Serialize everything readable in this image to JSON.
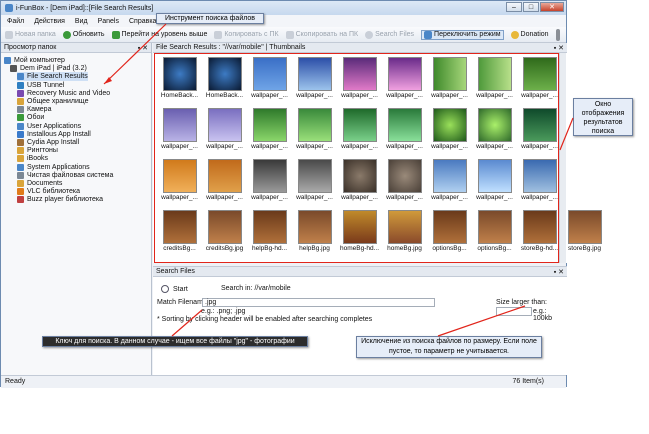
{
  "window": {
    "title": "i-FunBox - [Dem iPad]::[File Search Results]"
  },
  "menu": [
    "Файл",
    "Действия",
    "Вид",
    "Panels",
    "Справка"
  ],
  "toolbar": [
    {
      "label": "Новая папка",
      "icon": "new-folder-icon",
      "enabled": false
    },
    {
      "label": "Обновить",
      "icon": "refresh-icon",
      "enabled": true
    },
    {
      "label": "Перейти на уровень выше",
      "icon": "up-level-icon",
      "enabled": true
    },
    {
      "label": "Копировать с ПК",
      "icon": "copy-from-pc-icon",
      "enabled": false
    },
    {
      "label": "Скопировать на ПК",
      "icon": "copy-to-pc-icon",
      "enabled": false
    },
    {
      "label": "Search Files",
      "icon": "search-icon",
      "enabled": false
    },
    {
      "label": "Переключить режим",
      "icon": "view-mode-icon",
      "enabled": true
    },
    {
      "label": "Donation",
      "icon": "donation-icon",
      "enabled": true
    }
  ],
  "leftpane": {
    "title": "Просмотр папок",
    "items": [
      "Мой компьютер",
      "Dem iPad | iPad (3.2)",
      "File Search Results",
      "USB Tunnel",
      "Recovery Music and Video",
      "Общее хранилище",
      "Камера",
      "Обои",
      "User Applications",
      "Installous App Install",
      "Cydia App Install",
      "Рингтоны",
      "iBooks",
      "System Applications",
      "Чистая файловая система",
      "Documents",
      "VLC библиотека",
      "Buzz player библиотека"
    ]
  },
  "results": {
    "header": "File Search Results : \"//var/mobile\"  |  Thumbnails",
    "captions": [
      [
        "HomeBack...",
        "HomeBack...",
        "wallpaper_...",
        "wallpaper_...",
        "wallpaper_...",
        "wallpaper_...",
        "wallpaper_...",
        "wallpaper_...",
        "wallpaper_..."
      ],
      [
        "wallpaper_...",
        "wallpaper_...",
        "wallpaper_...",
        "wallpaper_...",
        "wallpaper_...",
        "wallpaper_...",
        "wallpaper_...",
        "wallpaper_...",
        "wallpaper_..."
      ],
      [
        "wallpaper_...",
        "wallpaper_...",
        "wallpaper_...",
        "wallpaper_...",
        "wallpaper_...",
        "wallpaper_...",
        "wallpaper_...",
        "wallpaper_...",
        "wallpaper_..."
      ],
      [
        "creditsBg...",
        "creditsBg.jpg",
        "helpBg-hd...",
        "helpBg.jpg",
        "homeBg-hd...",
        "homeBg.jpg",
        "optionsBg...",
        "optionsBg...",
        "storeBg-hd...",
        "storeBg.jpg"
      ]
    ]
  },
  "search": {
    "title": "Search Files",
    "start_label": "Start",
    "search_in": "Search in: //var/mobile",
    "match_label": "Match Filename:",
    "match_value": ".jpg",
    "examples": "e.g.: .png; .jpg",
    "size_label": "Size larger than:",
    "size_example": "e.g.: 100kb",
    "hint": "* Sorting by clicking header will be enabled after searching completes"
  },
  "status": {
    "left": "Ready",
    "right": "76 Item(s)"
  },
  "annotations": {
    "search_tool": "Инструмент поиска файлов",
    "results_window": "Окно отображения результатов поиска",
    "search_key": "Ключ для поиска. В данном случае - ищем все файлы \"jpg\" - фотографии",
    "size_exclude": "Исключение из поиска файлов по размеру. Если поле пустое, то параметр не учитывается."
  },
  "colors": {
    "highlight": "#e1251b",
    "note_bg": "#e6edf8",
    "note_dark": "#2c2c2c"
  }
}
